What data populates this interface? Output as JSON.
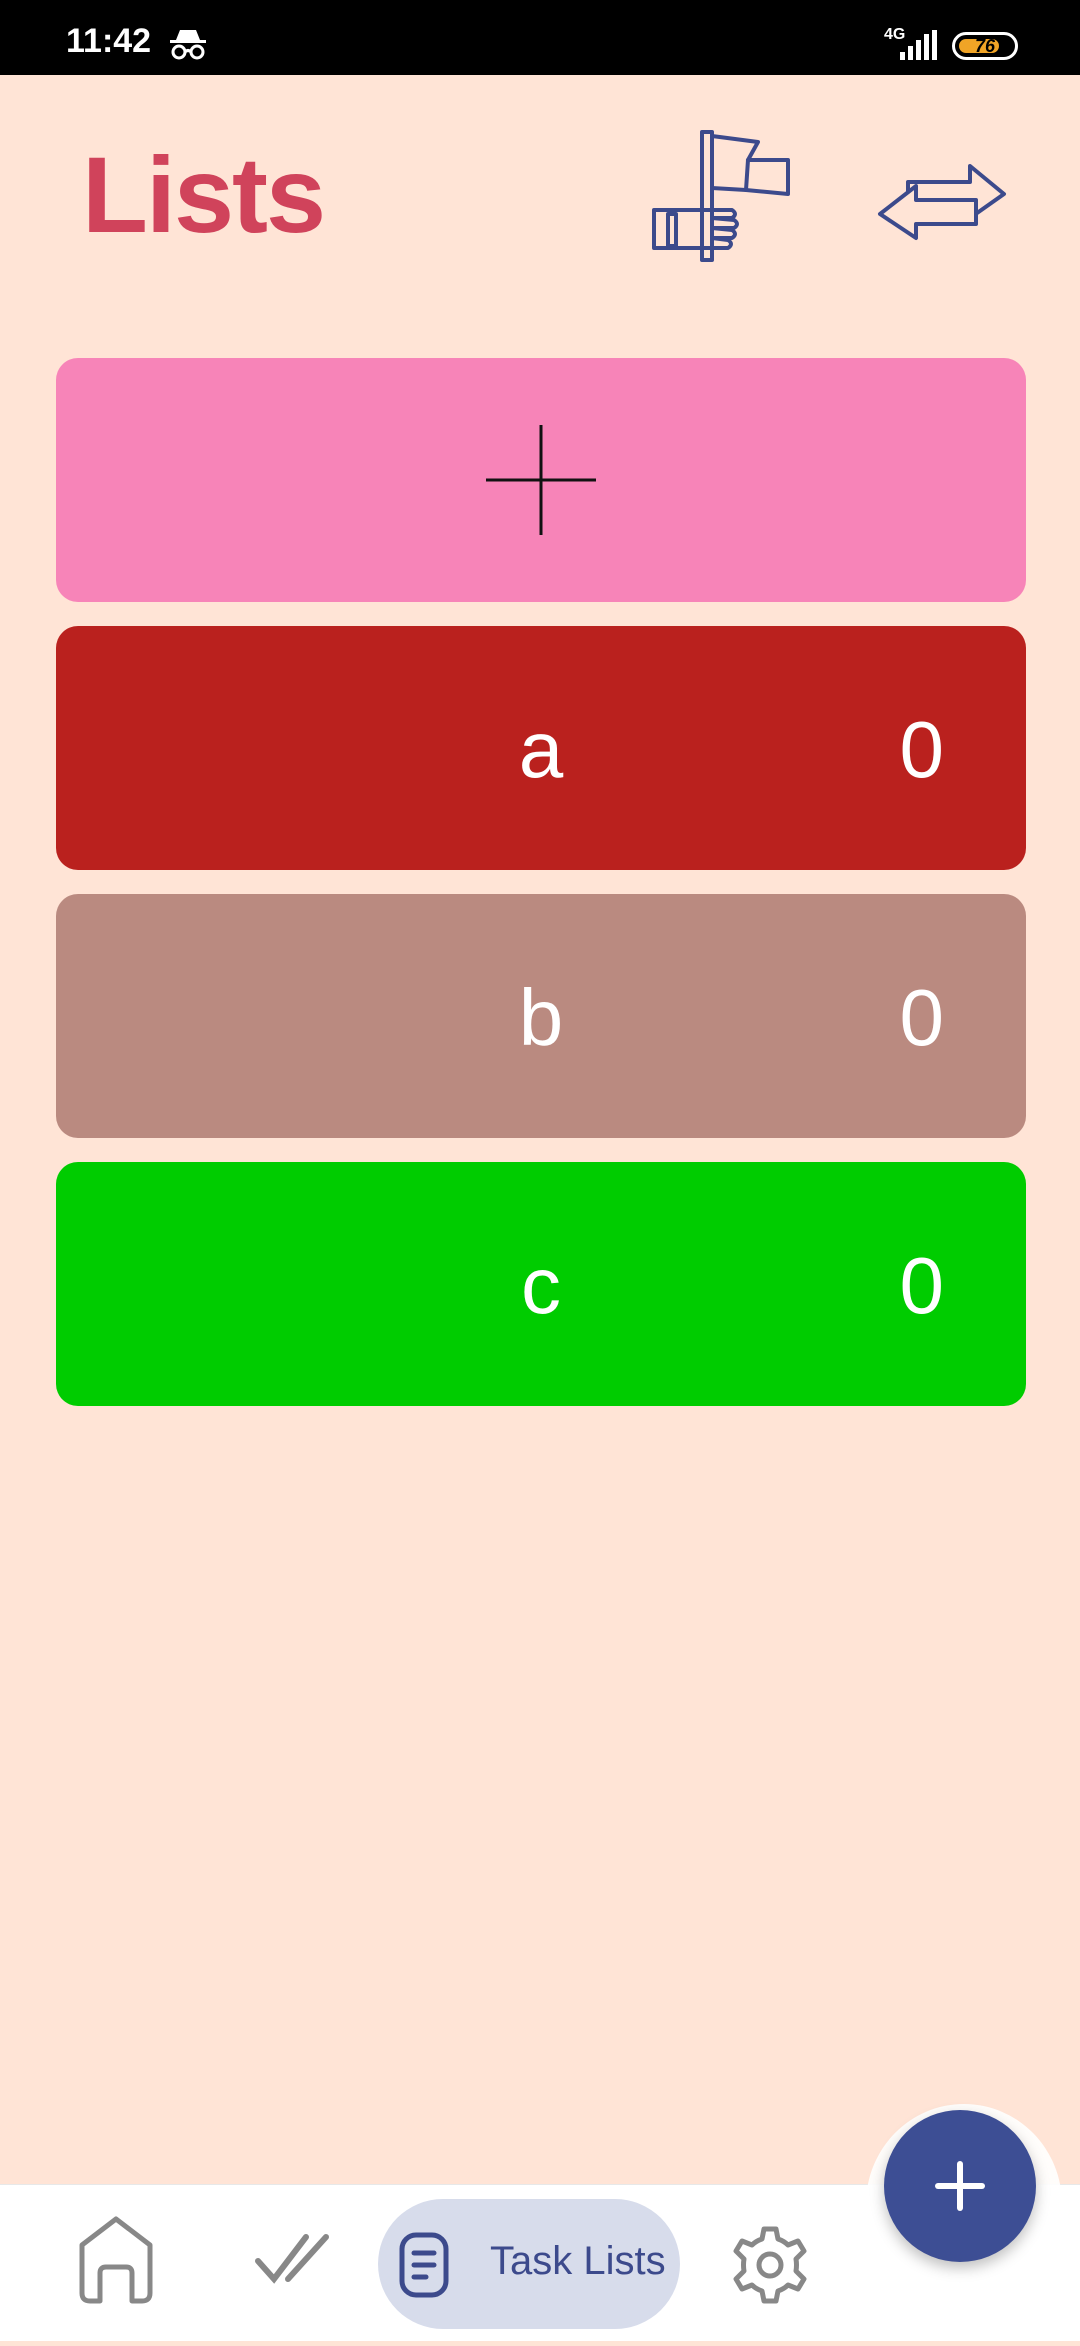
{
  "status_bar": {
    "time": "11:42",
    "network": "4G",
    "battery": "76",
    "battery_level": 0.76
  },
  "header": {
    "title": "Lists",
    "flag_icon": "hand-flag-icon",
    "swap_icon": "swap-arrows-icon"
  },
  "add_list": {
    "icon": "plus-icon",
    "color": "#F784B8"
  },
  "lists": [
    {
      "name": "a",
      "count": "0",
      "color": "#BA211E"
    },
    {
      "name": "b",
      "count": "0",
      "color": "#BA8A80"
    },
    {
      "name": "c",
      "count": "0",
      "color": "#00CC00"
    }
  ],
  "bottom_nav": {
    "items": [
      {
        "icon": "home-icon"
      },
      {
        "icon": "double-check-icon"
      },
      {
        "icon": "list-icon",
        "label": "Task Lists",
        "active": true
      },
      {
        "icon": "gear-icon"
      }
    ]
  },
  "fab": {
    "icon": "plus-icon",
    "color": "#3D4E94"
  },
  "colors": {
    "background": "#FFE4D6",
    "title": "#D0435B",
    "accent": "#3C4A8C"
  }
}
